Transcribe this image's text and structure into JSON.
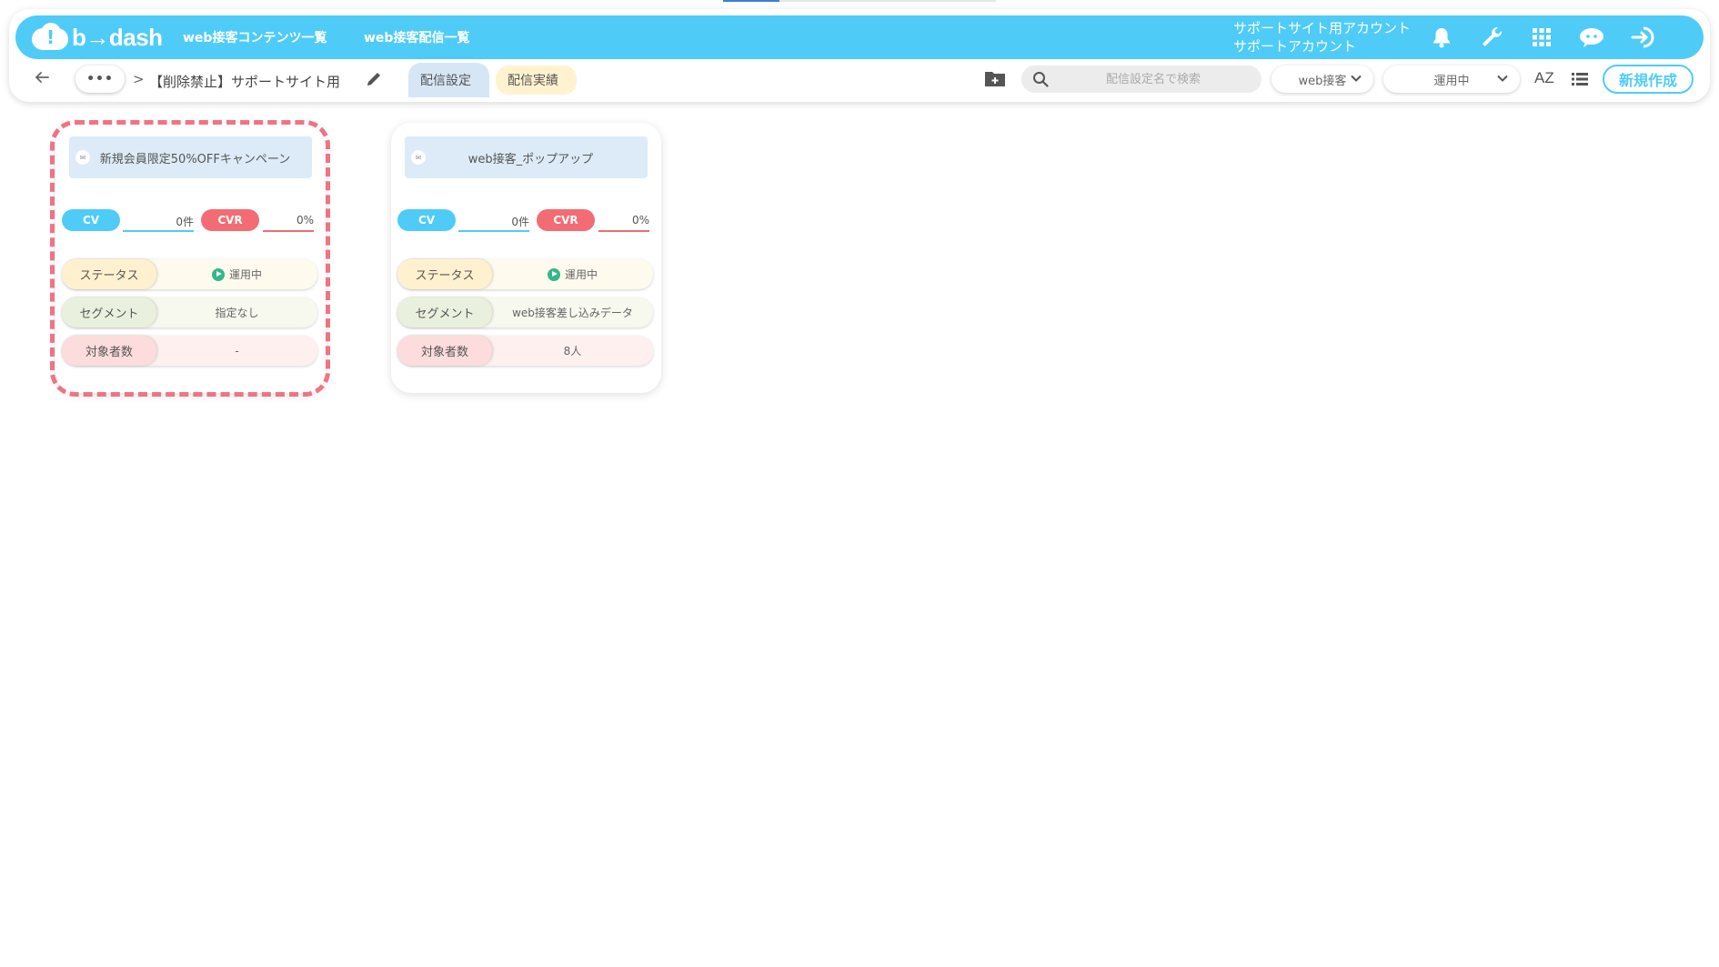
{
  "app": {
    "logo_text": "b→dash",
    "nav": [
      "web接客コンテンツ一覧",
      "web接客配信一覧"
    ],
    "account_line1": "サポートサイト用アカウント",
    "account_line2": "サポートアカウント",
    "accent_color": "#4fcbf8"
  },
  "toolbar": {
    "dots_label": "•••",
    "crumb_separator": ">",
    "title": "【削除禁止】サポートサイト用",
    "tabs": [
      "配信設定",
      "配信実績"
    ],
    "search_placeholder": "配信設定名で検索",
    "channel_select": "web接客",
    "status_select": "運用中",
    "sort_label": "AZ",
    "new_button": "新規作成"
  },
  "cards": [
    {
      "title": "新規会員限定50%OFFキャンペーン",
      "cv_label": "CV",
      "cv_value": "0件",
      "cvr_label": "CVR",
      "cvr_value": "0%",
      "status_label": "ステータス",
      "status_value": "運用中",
      "segment_label": "セグメント",
      "segment_value": "指定なし",
      "target_label": "対象者数",
      "target_value": "-"
    },
    {
      "title": "web接客_ポップアップ",
      "cv_label": "CV",
      "cv_value": "0件",
      "cvr_label": "CVR",
      "cvr_value": "0%",
      "status_label": "ステータス",
      "status_value": "運用中",
      "segment_label": "セグメント",
      "segment_value": "web接客差し込みデータ",
      "target_label": "対象者数",
      "target_value": "8人"
    }
  ]
}
